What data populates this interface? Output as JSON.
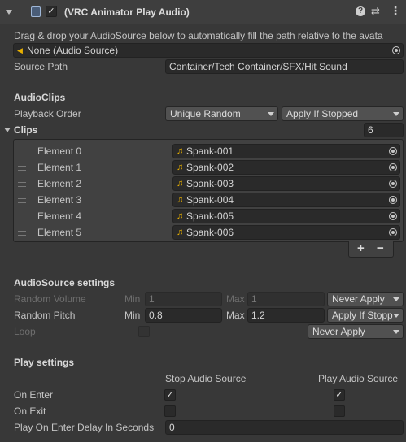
{
  "header": {
    "title": "(VRC Animator Play Audio)",
    "enabled": true,
    "icons": [
      "foldout-arrow",
      "script-icon",
      "help-icon",
      "preset-icon",
      "more-icon"
    ]
  },
  "description": "Drag & drop your AudioSource below to automatically fill the path relative to the avata",
  "audio_source_field": {
    "value": "None (Audio Source)"
  },
  "source_path": {
    "label": "Source Path",
    "value": "Container/Tech Container/SFX/Hit Sound"
  },
  "audioclips": {
    "section_title": "AudioClips",
    "playback_order_label": "Playback Order",
    "playback_order_value": "Unique Random",
    "apply_mode_value": "Apply If Stopped",
    "clips_label": "Clips",
    "clips_count": "6",
    "elements": [
      {
        "label": "Element 0",
        "clip": "Spank-001"
      },
      {
        "label": "Element 1",
        "clip": "Spank-002"
      },
      {
        "label": "Element 2",
        "clip": "Spank-003"
      },
      {
        "label": "Element 3",
        "clip": "Spank-004"
      },
      {
        "label": "Element 4",
        "clip": "Spank-005"
      },
      {
        "label": "Element 5",
        "clip": "Spank-006"
      }
    ],
    "add_button": "+",
    "remove_button": "−"
  },
  "audiosource_settings": {
    "section_title": "AudioSource settings",
    "random_volume": {
      "label": "Random Volume",
      "min_label": "Min",
      "min": "1",
      "max_label": "Max",
      "max": "1",
      "mode": "Never Apply"
    },
    "random_pitch": {
      "label": "Random Pitch",
      "min_label": "Min",
      "min": "0.8",
      "max_label": "Max",
      "max": "1.2",
      "mode": "Apply If Stopp"
    },
    "loop": {
      "label": "Loop",
      "mode": "Never Apply"
    }
  },
  "play_settings": {
    "section_title": "Play settings",
    "col_stop": "Stop Audio Source",
    "col_play": "Play Audio Source",
    "on_enter": {
      "label": "On Enter",
      "stop": true,
      "play": true
    },
    "on_exit": {
      "label": "On Exit",
      "stop": false,
      "play": false
    },
    "delay": {
      "label": "Play On Enter Delay In Seconds",
      "value": "0"
    }
  }
}
